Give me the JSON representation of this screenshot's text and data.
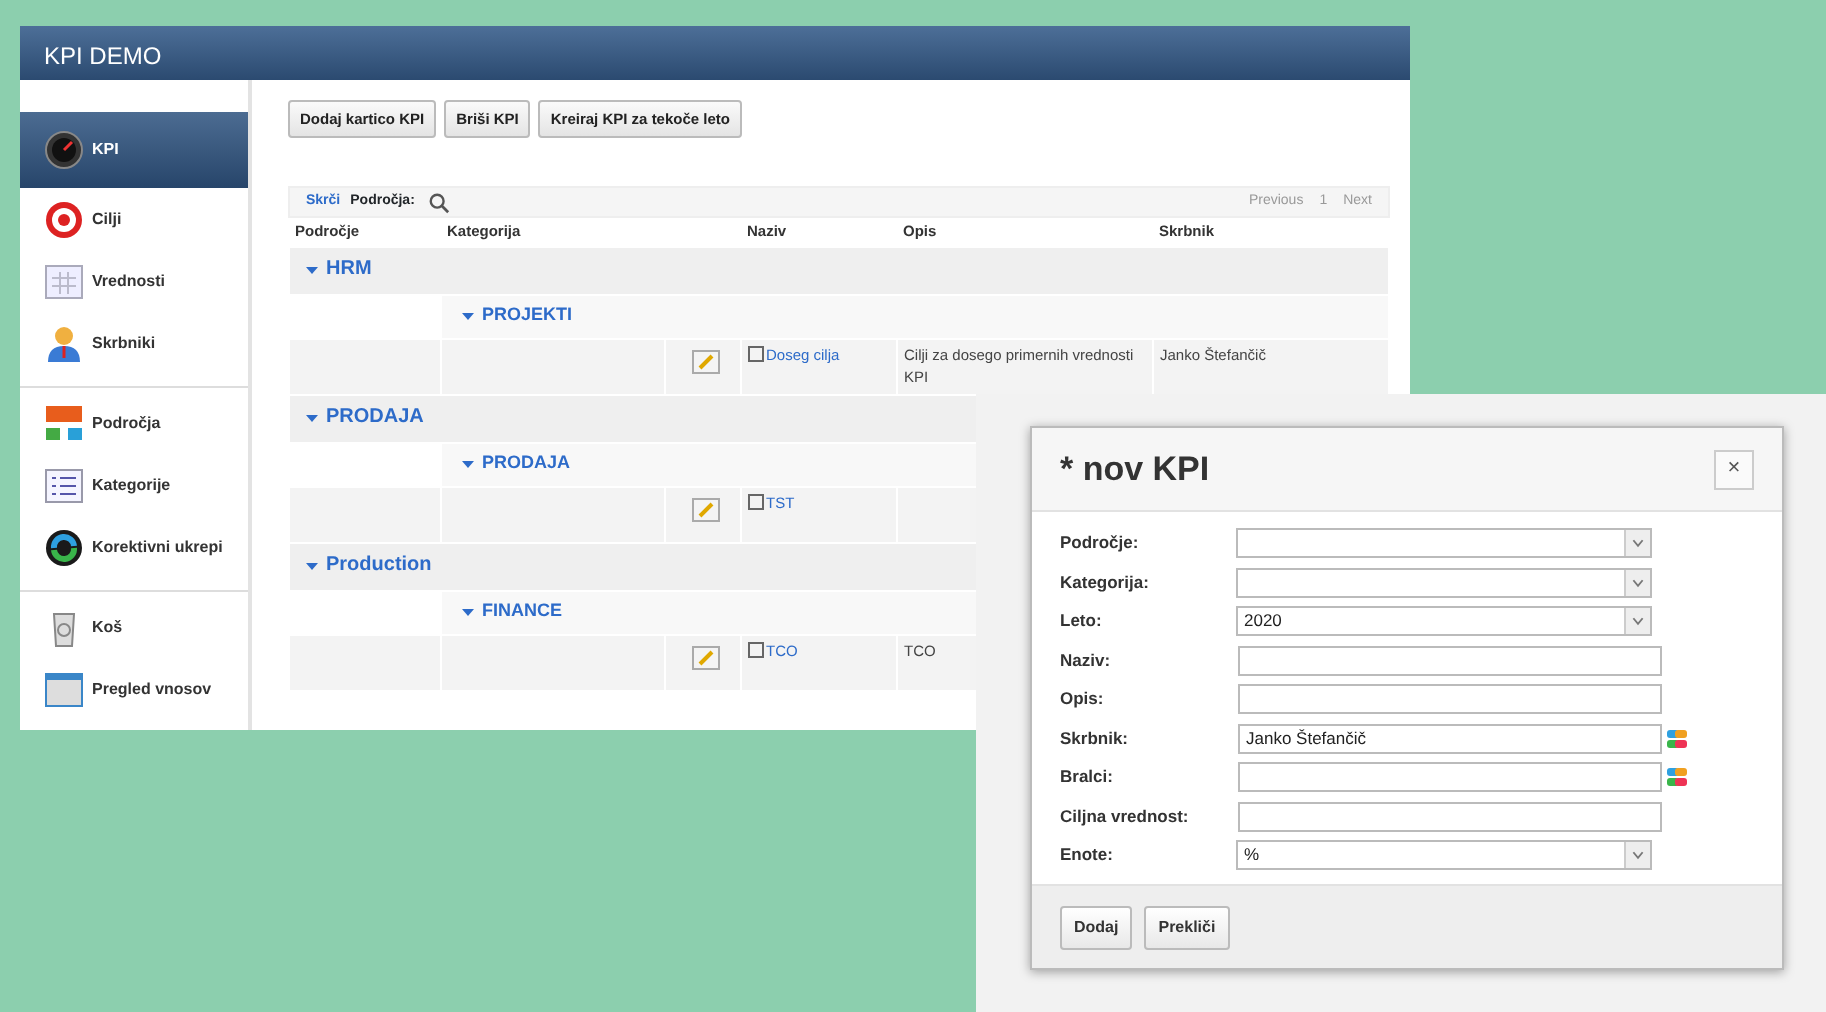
{
  "app": {
    "title": "KPI DEMO",
    "sidebar": [
      [
        {
          "label": "KPI",
          "kind": "gauge",
          "selected": true
        },
        {
          "label": "Cilji",
          "kind": "target",
          "selected": false
        },
        {
          "label": "Vrednosti",
          "kind": "calendar",
          "selected": false
        },
        {
          "label": "Skrbniki",
          "kind": "person",
          "selected": false
        }
      ],
      [
        {
          "label": "Področja",
          "kind": "blocks",
          "selected": false
        },
        {
          "label": "Kategorije",
          "kind": "list",
          "selected": false
        },
        {
          "label": "Korektivni ukrepi",
          "kind": "cycle",
          "selected": false
        }
      ],
      [
        {
          "label": "Koš",
          "kind": "bin",
          "selected": false
        },
        {
          "label": "Pregled vnosov",
          "kind": "window",
          "selected": false
        }
      ]
    ],
    "toolbar": [
      "Dodaj kartico KPI",
      "Briši KPI",
      "Kreiraj KPI za tekoče leto"
    ],
    "filter": {
      "link": "Skrči",
      "label": "Področja:"
    },
    "pager": {
      "previous": "Previous",
      "page": "1",
      "next": "Next"
    },
    "table": {
      "columns": [
        "Področje",
        "Kategorija",
        "Naziv",
        "Opis",
        "Skrbnik"
      ],
      "groups": [
        {
          "name": "HRM",
          "expanded": true,
          "categories": [
            {
              "name": "PROJEKTI",
              "expanded": true,
              "rows": [
                {
                  "name": "Doseg cilja",
                  "checked": false,
                  "description": "Cilji za dosego primernih vrednosti KPI",
                  "owner": "Janko Štefančič"
                }
              ]
            }
          ]
        },
        {
          "name": "PRODAJA",
          "expanded": true,
          "categories": [
            {
              "name": "PRODAJA",
              "expanded": true,
              "rows": [
                {
                  "name": "TST",
                  "checked": false
                }
              ]
            }
          ]
        },
        {
          "name": "Production",
          "expanded": true,
          "categories": [
            {
              "name": "FINANCE",
              "expanded": true,
              "rows": [
                {
                  "name": "TCO",
                  "checked": false,
                  "description": "TCO"
                }
              ]
            }
          ]
        }
      ]
    }
  },
  "dialog": {
    "title": "* nov KPI",
    "close": "×",
    "fields": [
      {
        "label": "Področje:",
        "kind": "select"
      },
      {
        "label": "Kategorija:",
        "kind": "select"
      },
      {
        "label": "Leto:",
        "kind": "select",
        "value": "2020"
      },
      {
        "label": "Naziv:",
        "kind": "text"
      },
      {
        "label": "Opis:",
        "kind": "text"
      },
      {
        "label": "Skrbnik:",
        "kind": "picker",
        "value": "Janko Štefančič"
      },
      {
        "label": "Bralci:",
        "kind": "picker"
      },
      {
        "label": "Ciljna vrednost:",
        "kind": "text"
      },
      {
        "label": "Enote:",
        "kind": "select",
        "value": "%"
      }
    ],
    "buttons": [
      "Dodaj",
      "Prekliči"
    ]
  }
}
